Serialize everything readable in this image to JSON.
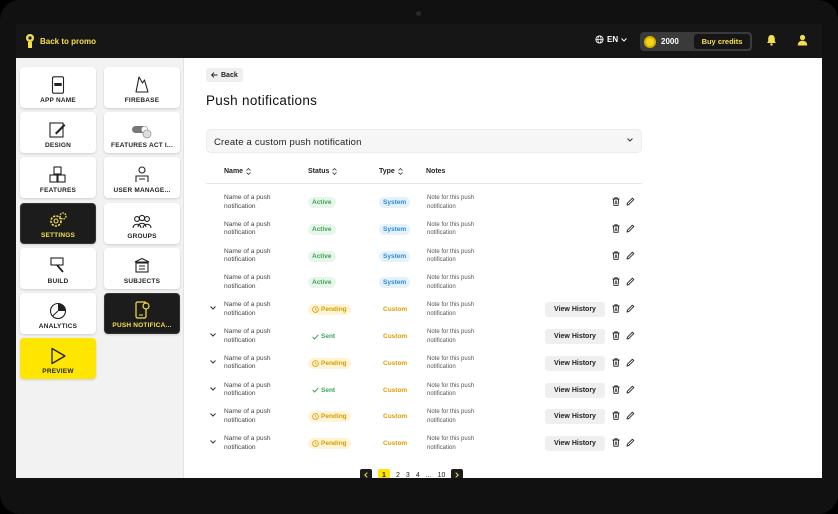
{
  "topbar": {
    "back_label": "Back to promo",
    "language": "EN",
    "credits": "2000",
    "buy_label": "Buy credits"
  },
  "nav_primary": [
    {
      "label": "APP NAME",
      "icon": "phone-name-icon"
    },
    {
      "label": "DESIGN",
      "icon": "design-icon"
    },
    {
      "label": "FEATURES",
      "icon": "features-icon"
    },
    {
      "label": "SETTINGS",
      "icon": "gear-icon"
    },
    {
      "label": "BUILD",
      "icon": "build-icon"
    },
    {
      "label": "ANALYTICS",
      "icon": "pie-chart-icon"
    },
    {
      "label": "PREVIEW",
      "icon": "play-icon"
    }
  ],
  "nav_secondary": [
    {
      "label": "FIREBASE",
      "icon": "firebase-icon"
    },
    {
      "label": "FEATURES ACT I...",
      "icon": "toggle-icon"
    },
    {
      "label": "USER MANAGE...",
      "icon": "user-manage-icon"
    },
    {
      "label": "GROUPS",
      "icon": "groups-icon"
    },
    {
      "label": "SUBJECTS",
      "icon": "subjects-icon"
    },
    {
      "label": "PUSH NOTIFICA...",
      "icon": "push-phone-icon"
    }
  ],
  "main": {
    "back_label": "Back",
    "title": "Push notifications",
    "create_label": "Create a custom push notification",
    "columns": {
      "name": "Name",
      "status": "Status",
      "type": "Type",
      "notes": "Notes"
    },
    "view_history_label": "View History",
    "rows": [
      {
        "name": "Name of a push notification",
        "status": "Active",
        "type": "System",
        "note": "Note for this push notification"
      },
      {
        "name": "Name of a push notification",
        "status": "Active",
        "type": "System",
        "note": "Note for this push notification"
      },
      {
        "name": "Name of a push notification",
        "status": "Active",
        "type": "System",
        "note": "Note for this push notification"
      },
      {
        "name": "Name of a push notification",
        "status": "Active",
        "type": "System",
        "note": "Note for this push notification"
      },
      {
        "name": "Name of a push notification",
        "status": "Pending",
        "type": "Custom",
        "note": "Note for this push notification"
      },
      {
        "name": "Name of a push notification",
        "status": "Sent",
        "type": "Custom",
        "note": "Note for this push notification"
      },
      {
        "name": "Name of a push notification",
        "status": "Pending",
        "type": "Custom",
        "note": "Note for this push notification"
      },
      {
        "name": "Name of a push notification",
        "status": "Sent",
        "type": "Custom",
        "note": "Note for this push notification"
      },
      {
        "name": "Name of a push notification",
        "status": "Pending",
        "type": "Custom",
        "note": "Note for this push notification"
      },
      {
        "name": "Name of a push notification",
        "status": "Pending",
        "type": "Custom",
        "note": "Note for this push notification"
      }
    ],
    "pagination": {
      "pages": [
        "1",
        "2",
        "3",
        "4",
        "...",
        "10"
      ]
    }
  }
}
